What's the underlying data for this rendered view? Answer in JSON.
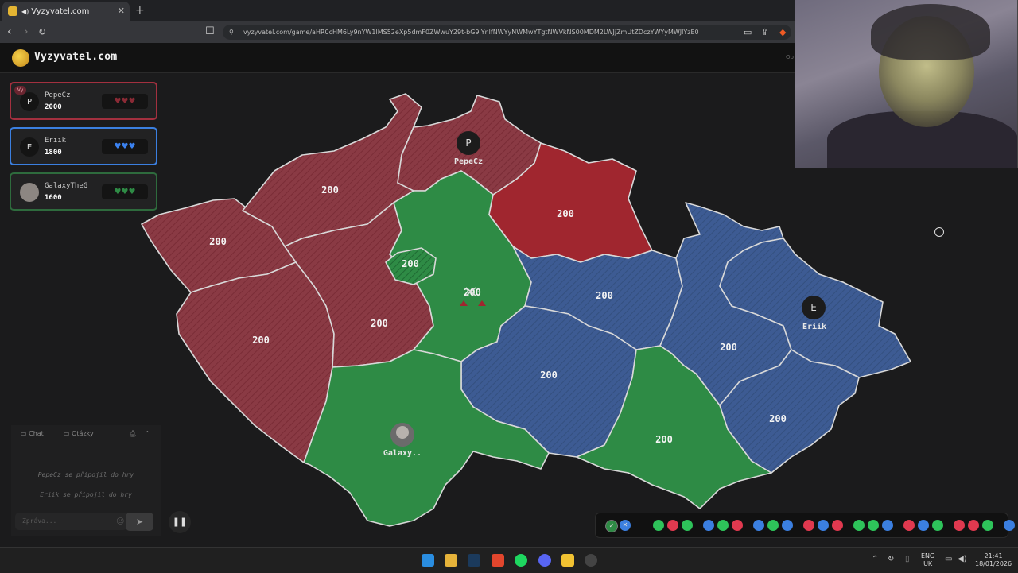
{
  "browser": {
    "tab_title": "Vyzyvatel.com",
    "url": "vyzyvatel.com/game/aHR0cHM6Ly9nYW1lMS52eXp5dmF0ZWwuY29t-bG9iYnlfNWYyNWMwYTgtNWVkNS00MDM2LWJjZmUtZDczYWYyMWJlYzE0"
  },
  "site": {
    "logo": "Vyzyvatel.com",
    "header_right": "Ob"
  },
  "players": [
    {
      "initial": "P",
      "name": "PepeCz",
      "score": "2000",
      "badge": "Vy",
      "hearts": "♥♥♥",
      "color": "#a3303f"
    },
    {
      "initial": "E",
      "name": "Eriik",
      "score": "1800",
      "badge": "",
      "hearts": "♥♥♥",
      "color": "#3b7fe0"
    },
    {
      "initial": "",
      "name": "GalaxyTheG",
      "score": "1600",
      "badge": "",
      "hearts": "♥♥♥",
      "color": "#2e8b45"
    }
  ],
  "chat": {
    "tab_chat": "Chat",
    "tab_questions": "Otázky",
    "messages": [
      "PepeCz se připojil do hry",
      "Eriik se připojil do hry"
    ],
    "placeholder": "Zpráva..."
  },
  "map": {
    "regions": [
      {
        "id": "ustecky",
        "owner": "red",
        "value": "200"
      },
      {
        "id": "karlovarsky",
        "owner": "red",
        "value": "200"
      },
      {
        "id": "liberecky",
        "owner": "red",
        "value": ""
      },
      {
        "id": "plzensky",
        "owner": "red",
        "value": "200"
      },
      {
        "id": "stredocesky-west",
        "owner": "red",
        "value": "200"
      },
      {
        "id": "praha",
        "owner": "green",
        "value": "200"
      },
      {
        "id": "stredocesky",
        "owner": "green",
        "value": "200"
      },
      {
        "id": "kralovehradecky",
        "owner": "crimson",
        "value": "200"
      },
      {
        "id": "pardubicky",
        "owner": "blue",
        "value": "200"
      },
      {
        "id": "vysocina",
        "owner": "blue",
        "value": "200"
      },
      {
        "id": "jihocesky",
        "owner": "green",
        "value": ""
      },
      {
        "id": "jihomoravsky",
        "owner": "green",
        "value": "200"
      },
      {
        "id": "olomoucky",
        "owner": "blue",
        "value": "200"
      },
      {
        "id": "moravskoslezsky",
        "owner": "blue",
        "value": ""
      },
      {
        "id": "zlinsky",
        "owner": "blue",
        "value": "200"
      }
    ],
    "markers": [
      {
        "initial": "P",
        "name": "PepeCz"
      },
      {
        "initial": "E",
        "name": "Eriik"
      },
      {
        "initial": "",
        "name": "Galaxy.."
      }
    ],
    "colors": {
      "red": "#8a3a44",
      "crimson": "#a0262f",
      "green": "#2e8b45",
      "blue": "#3d5b93"
    }
  },
  "history": {
    "status_icons": [
      "check-icon",
      "swords-icon"
    ],
    "dots": [
      "green",
      "red",
      "green",
      "blue",
      "green",
      "red",
      "blue",
      "green",
      "blue",
      "red",
      "blue",
      "red",
      "green",
      "green",
      "blue",
      "red",
      "blue",
      "green",
      "red",
      "red",
      "green",
      "blue"
    ]
  },
  "taskbar": {
    "lang": "ENG",
    "region": "UK",
    "time": "21:41",
    "date": "18/01/2026"
  }
}
